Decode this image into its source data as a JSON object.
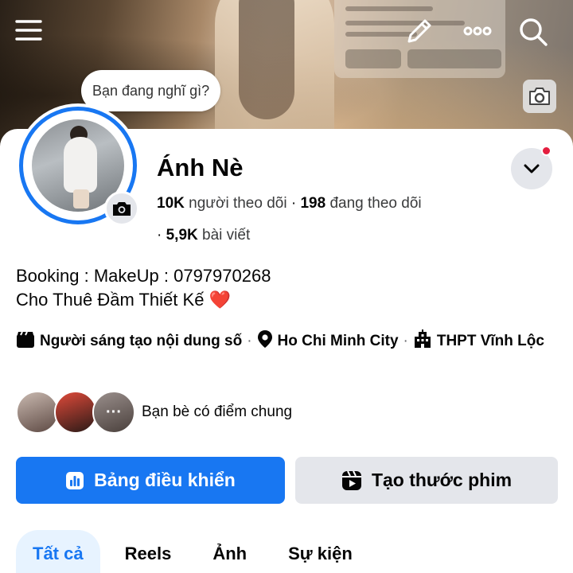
{
  "status_prompt": "Bạn đang nghĩ gì?",
  "profile": {
    "name": "Ánh Nè",
    "followers_count": "10K",
    "followers_label": "người theo dõi",
    "following_count": "198",
    "following_label": "đang theo dõi",
    "posts_count": "5,9K",
    "posts_label": "bài viết"
  },
  "bio": {
    "line1": "Booking : MakeUp : 0797970268",
    "line2": "Cho Thuê Đầm Thiết Kế",
    "line2_emoji": "❤️"
  },
  "details": {
    "category": "Người sáng tạo nội dung số",
    "location": "Ho Chi Minh City",
    "school": "THPT Vĩnh Lộc",
    "separator": "·"
  },
  "mutual": {
    "label": "Bạn bè có điểm chung",
    "more_glyph": "···"
  },
  "buttons": {
    "dashboard": "Bảng điều khiển",
    "create_reel": "Tạo thước phim"
  },
  "tabs": [
    {
      "label": "Tất cả",
      "active": true
    },
    {
      "label": "Reels",
      "active": false
    },
    {
      "label": "Ảnh",
      "active": false
    },
    {
      "label": "Sự kiện",
      "active": false
    }
  ],
  "icons": {
    "menu": "hamburger-menu-icon",
    "edit": "pencil-icon",
    "more": "more-dots-icon",
    "search": "search-icon",
    "camera": "camera-icon",
    "dropdown": "chevron-down-icon",
    "category": "clapperboard-icon",
    "location": "location-pin-icon",
    "school": "school-building-icon",
    "dashboard": "bar-chart-icon",
    "reel": "reel-icon"
  },
  "colors": {
    "accent": "#1877f2",
    "notification_dot": "#e41e3f",
    "secondary_button": "#e4e6eb",
    "active_tab_bg": "#e7f3ff"
  }
}
